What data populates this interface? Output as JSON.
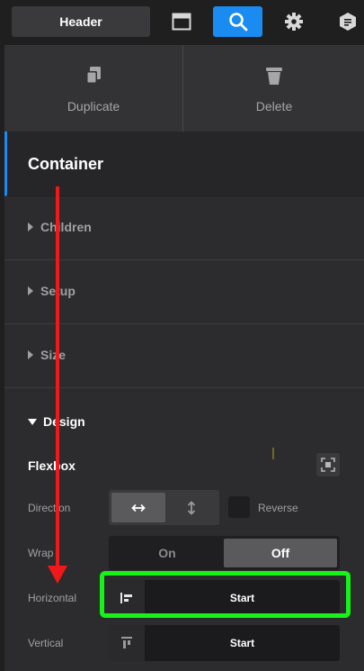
{
  "topbar": {
    "header_label": "Header",
    "icons": [
      "window-icon",
      "search-icon",
      "gear-icon",
      "docs-icon"
    ],
    "active_color": "#1a8bf0"
  },
  "actions": {
    "duplicate_label": "Duplicate",
    "delete_label": "Delete"
  },
  "element": {
    "title": "Container"
  },
  "sections": {
    "children": "Children",
    "setup": "Setup",
    "size": "Size",
    "design": "Design"
  },
  "design": {
    "group_title": "Flexbox",
    "direction_label": "Direction",
    "direction_options": [
      "↔",
      "↕"
    ],
    "direction_selected": "↔",
    "reverse_label": "Reverse",
    "reverse_checked": false,
    "wrap_label": "Wrap",
    "wrap_on": "On",
    "wrap_off": "Off",
    "wrap_selected": "Off",
    "horizontal_label": "Horizontal",
    "horizontal_value": "Start",
    "vertical_label": "Vertical",
    "vertical_value": "Start"
  },
  "annotations": {
    "highlight_color": "#17f217",
    "arrow_color": "#f01818"
  }
}
